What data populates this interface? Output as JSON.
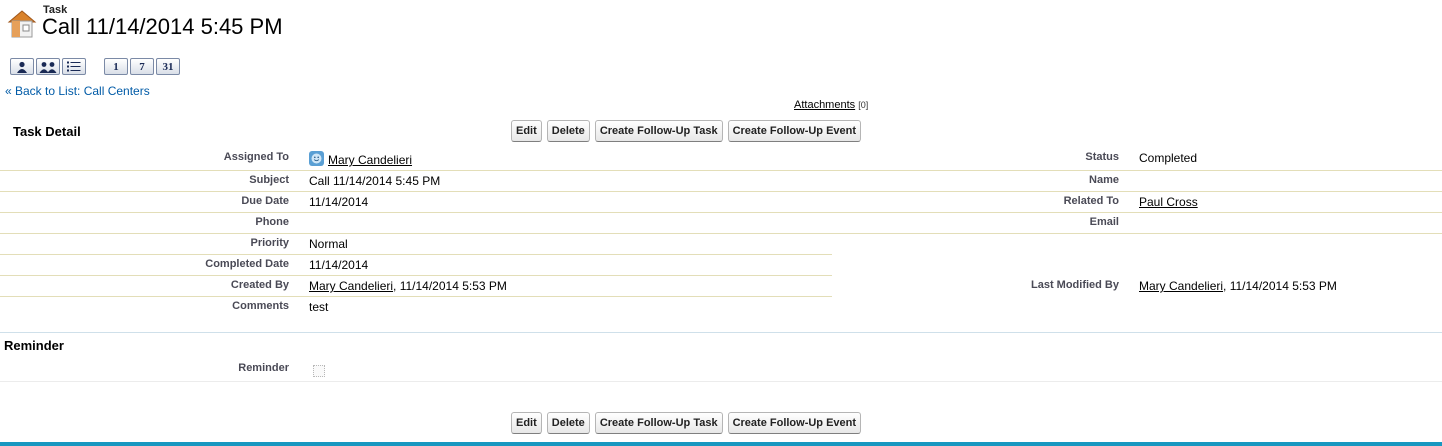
{
  "header": {
    "object_type": "Task",
    "title": "Call 11/14/2014 5:45 PM"
  },
  "view_buttons": [
    "1",
    "7",
    "31"
  ],
  "back_link": "« Back to List: Call Centers",
  "attachments": {
    "label": "Attachments",
    "count": "[0]"
  },
  "detail": {
    "section_title": "Task Detail",
    "buttons": {
      "edit": "Edit",
      "delete": "Delete",
      "follow_up_task": "Create Follow-Up Task",
      "follow_up_event": "Create Follow-Up Event"
    },
    "left": [
      {
        "label": "Assigned To",
        "value": "Mary Candelieri"
      },
      {
        "label": "Subject",
        "value": "Call 11/14/2014 5:45 PM"
      },
      {
        "label": "Due Date",
        "value": "11/14/2014"
      },
      {
        "label": "Phone",
        "value": ""
      },
      {
        "label": "Priority",
        "value": "Normal"
      },
      {
        "label": "Completed Date",
        "value": "11/14/2014"
      },
      {
        "label": "Created By",
        "value": "Mary Candelieri",
        "suffix": ", 11/14/2014 5:53 PM"
      },
      {
        "label": "Comments",
        "value": "test"
      }
    ],
    "right": [
      {
        "label": "Status",
        "value": "Completed"
      },
      {
        "label": "Name",
        "value": ""
      },
      {
        "label": "Related To",
        "value": "Paul Cross"
      },
      {
        "label": "Email",
        "value": ""
      },
      {
        "label": "Last Modified By",
        "value": "Mary Candelieri",
        "suffix": ", 11/14/2014 5:53 PM"
      }
    ]
  },
  "reminder": {
    "section_title": "Reminder",
    "label": "Reminder",
    "checked": false
  },
  "colors": {
    "link_blue": "#015ba7",
    "bottom_bar": "#1797c0",
    "row_rule": "#e3deb8"
  }
}
